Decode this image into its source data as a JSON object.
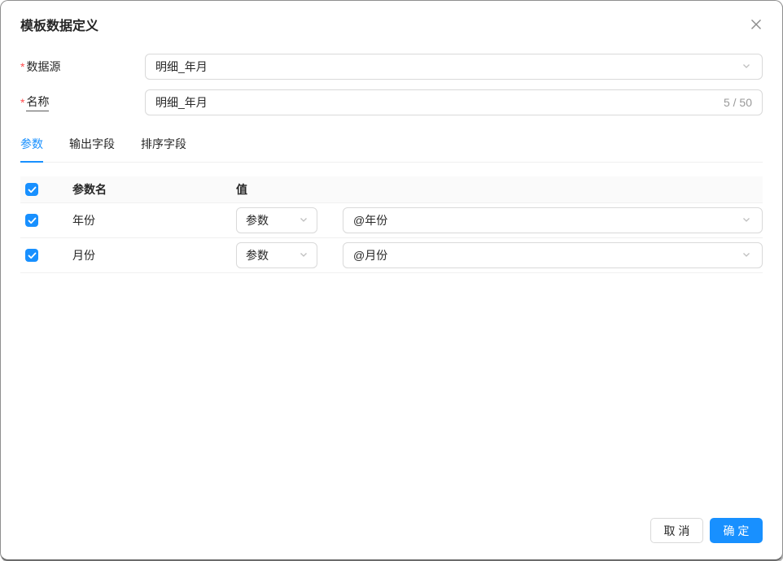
{
  "dialog": {
    "title": "模板数据定义"
  },
  "form": {
    "datasource": {
      "required": "*",
      "label": "数据源",
      "value": "明细_年月"
    },
    "name": {
      "required": "*",
      "label": "名称",
      "value": "明细_年月",
      "counter": "5 / 50"
    }
  },
  "tabs": [
    {
      "label": "参数",
      "active": true
    },
    {
      "label": "输出字段",
      "active": false
    },
    {
      "label": "排序字段",
      "active": false
    }
  ],
  "table": {
    "headers": {
      "name": "参数名",
      "value": "值"
    },
    "rows": [
      {
        "checked": true,
        "name": "年份",
        "type": "参数",
        "value": "@年份"
      },
      {
        "checked": true,
        "name": "月份",
        "type": "参数",
        "value": "@月份"
      }
    ]
  },
  "footer": {
    "cancel": "取 消",
    "confirm": "确 定"
  },
  "colors": {
    "accent": "#1890ff",
    "required": "#ff4d4f",
    "input_border": "#d9d9d9",
    "header_bg": "#fafafa"
  }
}
